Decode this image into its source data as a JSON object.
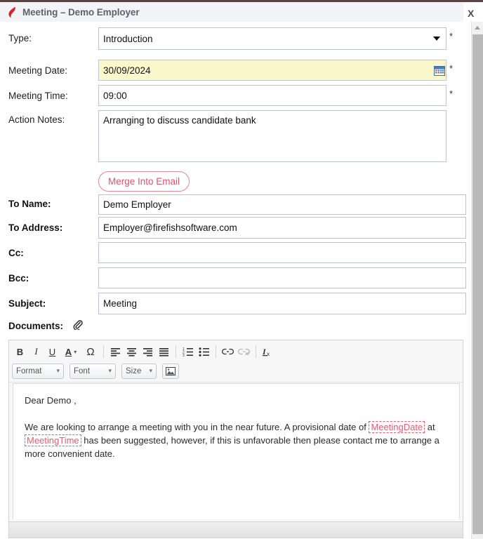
{
  "window": {
    "title": "Meeting – Demo Employer",
    "close_label": "X",
    "logo_icon": "firefish-flame-icon"
  },
  "form": {
    "fields": [
      {
        "label": "Type:",
        "value": "Introduction",
        "type": "select",
        "required": "*",
        "options": [
          "Introduction"
        ]
      },
      {
        "label": "Meeting Date:",
        "value": "30/09/2024",
        "type": "date",
        "required": "*",
        "icon": "calendar-icon"
      },
      {
        "label": "Meeting Time:",
        "value": "09:00",
        "type": "text",
        "required": "*"
      },
      {
        "label": "Action Notes:",
        "value": "Arranging to discuss candidate bank",
        "type": "textarea",
        "required": ""
      },
      {
        "label": "To Name:",
        "value": "Demo Employer",
        "type": "text",
        "required": ""
      },
      {
        "label": "To Address:",
        "value": "Employer@firefishsoftware.com",
        "type": "text",
        "required": ""
      },
      {
        "label": "Cc:",
        "value": "",
        "type": "text",
        "required": ""
      },
      {
        "label": "Bcc:",
        "value": "",
        "type": "text",
        "required": ""
      },
      {
        "label": "Subject:",
        "value": "Meeting",
        "type": "text",
        "required": ""
      },
      {
        "label": "Documents:",
        "value": "",
        "type": "attachment",
        "required": "",
        "icon": "paperclip-icon"
      }
    ],
    "merge_button": "Merge Into Email"
  },
  "editor": {
    "toolbar": {
      "bold": "B",
      "italic": "I",
      "underline": "U",
      "text_color": "A",
      "special_char": "Ω",
      "align_left": "align-left-icon",
      "align_center": "align-center-icon",
      "align_right": "align-right-icon",
      "align_justify": "align-justify-icon",
      "numbered_list": "numbered-list-icon",
      "bulleted_list": "bulleted-list-icon",
      "link": "link-icon",
      "unlink": "unlink-icon",
      "remove_format": "remove-format-icon",
      "format_label": "Format",
      "font_label": "Font",
      "size_label": "Size",
      "image_label": "image-icon"
    },
    "body": {
      "greeting": "Dear  Demo ,",
      "paragraph_part1": "We are looking to arrange a meeting with you in the near future. A provisional date of ",
      "merge_date": "MeetingDate",
      "paragraph_part2": " at ",
      "merge_time": "MeetingTime",
      "paragraph_part3": " has been suggested, however, if this is unfavorable then please contact me to arrange a more convenient date."
    }
  },
  "colors": {
    "accent_red": "#e1526f",
    "merge_tag": "#ef5a6f",
    "highlight_yellow": "#fbf8cc",
    "title_bar": "#f2f4f7",
    "border": "#b8c4d4"
  }
}
